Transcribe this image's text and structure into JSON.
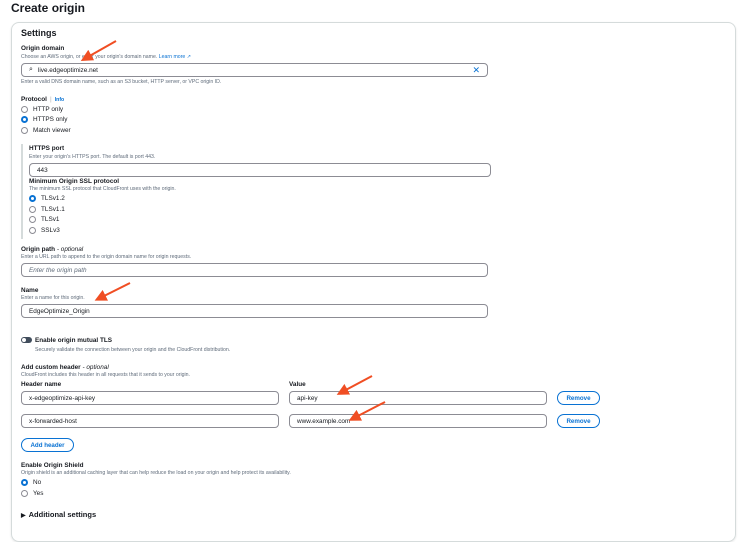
{
  "page_title": "Create origin",
  "settings": "Settings",
  "origin_domain": {
    "label": "Origin domain",
    "desc": "Choose an AWS origin, or enter your origin's domain name.",
    "learn_more": "Learn more",
    "value": "live.edgeoptimize.net",
    "hint": "Enter a valid DNS domain name, such as an S3 bucket, HTTP server, or VPC origin ID."
  },
  "protocol": {
    "label": "Protocol",
    "info": "Info",
    "options": [
      "HTTP only",
      "HTTPS only",
      "Match viewer"
    ],
    "selected": "HTTPS only"
  },
  "https_port": {
    "label": "HTTPS port",
    "desc": "Enter your origin's HTTPS port. The default is port 443.",
    "value": "443"
  },
  "ssl": {
    "label": "Minimum Origin SSL protocol",
    "desc": "The minimum SSL protocol that CloudFront uses with the origin.",
    "options": [
      "TLSv1.2",
      "TLSv1.1",
      "TLSv1",
      "SSLv3"
    ],
    "selected": "TLSv1.2"
  },
  "origin_path": {
    "label": "Origin path",
    "optional": "- optional",
    "desc": "Enter a URL path to append to the origin domain name for origin requests.",
    "placeholder": "Enter the origin path"
  },
  "name": {
    "label": "Name",
    "desc": "Enter a name for this origin.",
    "value": "EdgeOptimize_Origin"
  },
  "mtls": {
    "label": "Enable origin mutual TLS",
    "desc": "Securely validate the connection between your origin and the CloudFront distribution.",
    "enabled": false
  },
  "custom_header": {
    "label": "Add custom header",
    "optional": "- optional",
    "desc": "CloudFront includes this header in all requests that it sends to your origin.",
    "col_name": "Header name",
    "col_value": "Value",
    "rows": [
      {
        "name": "x-edgeoptimize-api-key",
        "value": "api-key"
      },
      {
        "name": "x-forwarded-host",
        "value": "www.example.com"
      }
    ],
    "remove": "Remove",
    "add": "Add header"
  },
  "shield": {
    "label": "Enable Origin Shield",
    "desc": "Origin shield is an additional caching layer that can help reduce the load on your origin and help protect its availability.",
    "options": [
      "No",
      "Yes"
    ],
    "selected": "No"
  },
  "additional": "Additional settings",
  "colors": {
    "accent": "#0972d3",
    "arrow": "#f04e23"
  }
}
